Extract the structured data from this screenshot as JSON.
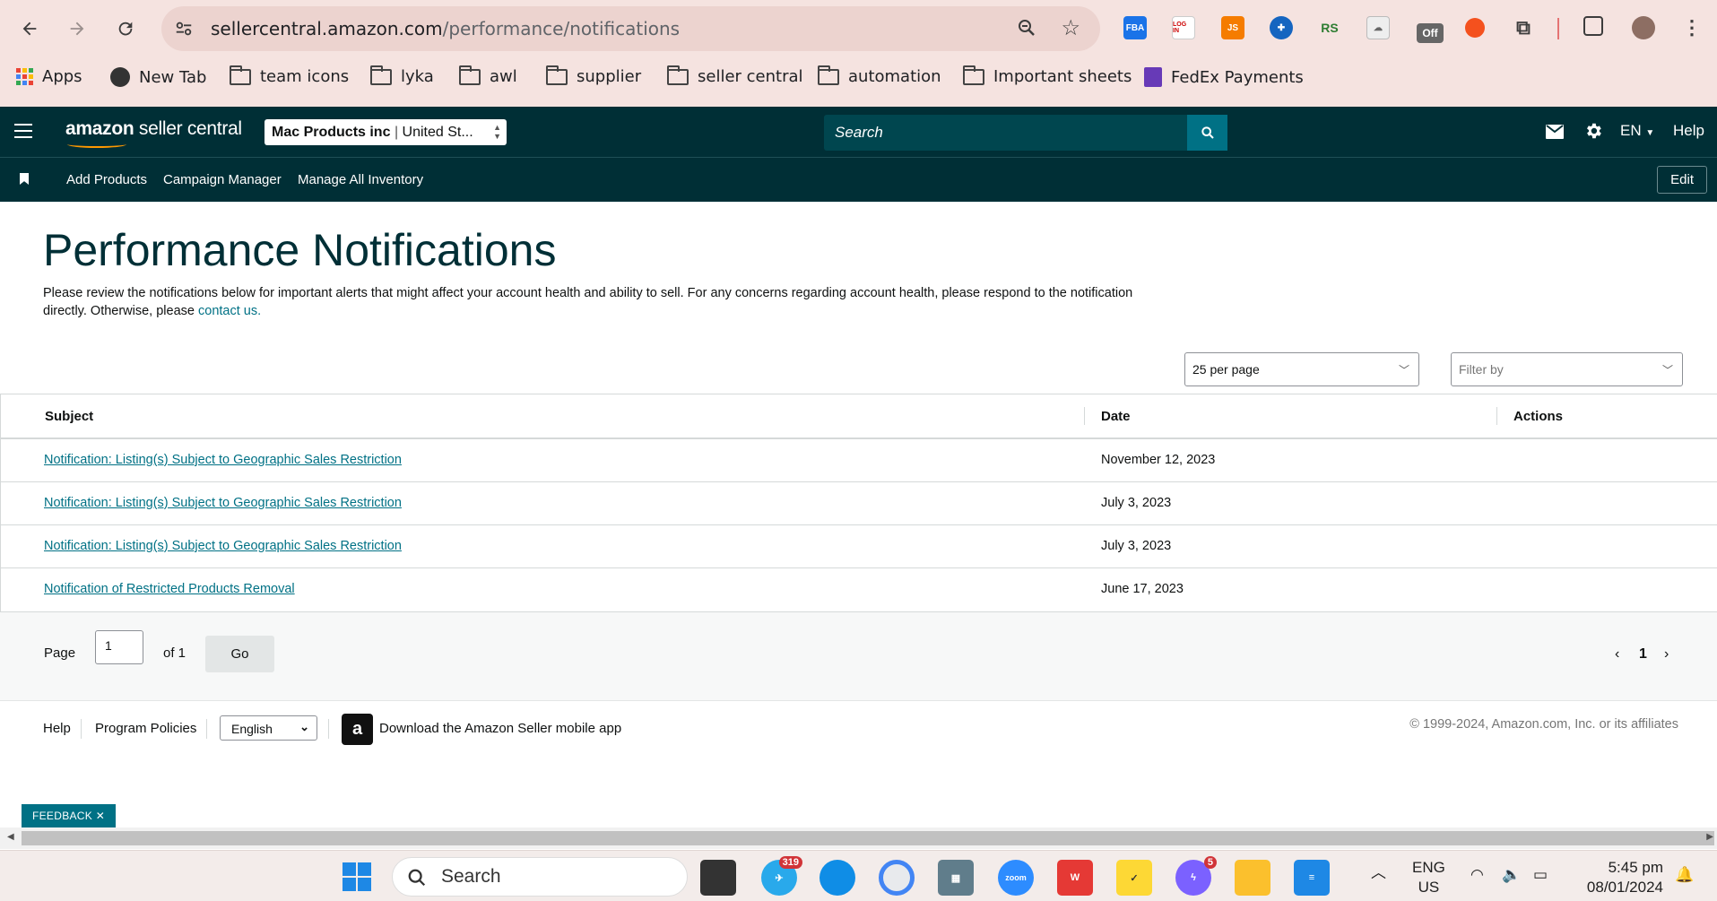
{
  "browser": {
    "url_host": "sellercentral.amazon.com",
    "url_path": "/performance/notifications",
    "bookmarks": [
      "Apps",
      "New Tab",
      "team icons",
      "lyka",
      "awl",
      "supplier",
      "seller central",
      "automation",
      "Important sheets",
      "FedEx Payments"
    ],
    "extensions": {
      "fba": "FBA",
      "login": "LOG IN",
      "js": "JS",
      "rs": "RS",
      "off": "Off"
    }
  },
  "header": {
    "logo_main": "amazon",
    "logo_sub": " seller central",
    "account_name": "Mac Products inc",
    "account_region": "United St...",
    "search_placeholder": "Search",
    "language": "EN",
    "help": "Help"
  },
  "subnav": {
    "items": [
      "Add Products",
      "Campaign Manager",
      "Manage All Inventory"
    ],
    "edit": "Edit"
  },
  "page": {
    "title": "Performance Notifications",
    "intro_text": "Please review the notifications below for important alerts that might affect your account health and ability to sell. For any concerns regarding account health, please respond to the notification directly. Otherwise, please ",
    "intro_link": "contact us."
  },
  "controls": {
    "per_page": "25 per page",
    "filter_placeholder": "Filter by"
  },
  "table": {
    "headers": {
      "subject": "Subject",
      "date": "Date",
      "actions": "Actions"
    },
    "rows": [
      {
        "subject": "Notification: Listing(s) Subject to Geographic Sales Restriction",
        "date": "November 12, 2023"
      },
      {
        "subject": "Notification: Listing(s) Subject to Geographic Sales Restriction",
        "date": "July 3, 2023"
      },
      {
        "subject": "Notification: Listing(s) Subject to Geographic Sales Restriction",
        "date": "July 3, 2023"
      },
      {
        "subject": "Notification of Restricted Products Removal",
        "date": "June 17, 2023"
      }
    ]
  },
  "pagination": {
    "page_label": "Page",
    "page_value": "1",
    "of_label": "of 1",
    "go": "Go",
    "current": "1"
  },
  "footer": {
    "help": "Help",
    "policies": "Program Policies",
    "language": "English",
    "app_icon_letter": "a",
    "download": "Download the Amazon Seller mobile app",
    "copyright": "© 1999-2024, Amazon.com, Inc. or its affiliates"
  },
  "feedback": "FEEDBACK",
  "taskbar": {
    "search": "Search",
    "telegram_badge": "319",
    "messenger_badge": "5",
    "zoom": "zoom",
    "lang_line1": "ENG",
    "lang_line2": "US",
    "time": "5:45 pm",
    "date": "08/01/2024"
  },
  "colors": {
    "header_bg": "#002f36",
    "link": "#007185",
    "chrome_bg": "#f5e3e0"
  }
}
